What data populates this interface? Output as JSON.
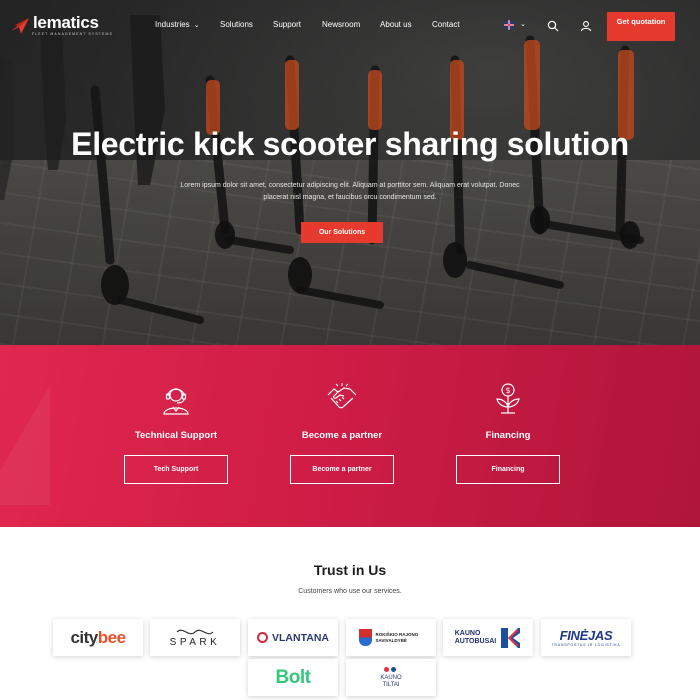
{
  "brand": {
    "name": "lematics",
    "tagline": "FLEET MANAGEMENT SYSTEMS",
    "accent": "#e63a2e"
  },
  "nav": {
    "items": [
      {
        "label": "Industries",
        "dropdown": true
      },
      {
        "label": "Solutions"
      },
      {
        "label": "Support"
      },
      {
        "label": "Newsroom"
      },
      {
        "label": "About us"
      },
      {
        "label": "Contact"
      }
    ],
    "language_icon": "uk-flag-icon",
    "search_icon": "search-icon",
    "account_icon": "user-icon",
    "cta_label": "Get quotation"
  },
  "hero": {
    "title": "Electric kick scooter sharing solution",
    "text": "Lorem ipsum dolor sit amet, consectetur adipiscing elit. Aliquam at porttitor sem. Aliquam erat volutpat. Donec placerat nisl magna, et faucibus orcu condimentum sed.",
    "button_label": "Our Solutions"
  },
  "services": {
    "background": "#d2204a",
    "items": [
      {
        "title": "Technical Support",
        "button": "Tech Support",
        "icon": "headset-agent-icon"
      },
      {
        "title": "Become a partner",
        "button": "Become a partner",
        "icon": "handshake-icon"
      },
      {
        "title": "Financing",
        "button": "Financing",
        "icon": "money-plant-icon"
      }
    ]
  },
  "trust": {
    "title": "Trust in Us",
    "subtitle": "Customers who use our services.",
    "logos": {
      "citybee": {
        "a": "city",
        "b": "bee"
      },
      "spark": "SPARK",
      "vlantana": "VLANTANA",
      "rokiskio": "ROKIŠKIO RAJONO SAVIVALDYBĖ",
      "kauno_autobusai": {
        "line1": "KAUNO",
        "line2": "AUTOBUSAI"
      },
      "finejas": {
        "big": "FINĖJAS",
        "small": "TRANSPORTAS IR LOGISTIKA"
      },
      "bolt": "Bolt",
      "kauno_tiltai": {
        "line1": "KAUNO",
        "line2": "TILTAI"
      }
    }
  }
}
